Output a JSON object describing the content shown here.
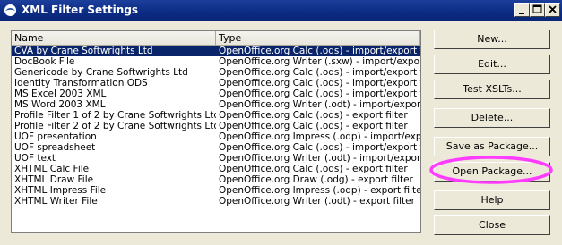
{
  "window": {
    "title": "XML Filter Settings"
  },
  "list": {
    "columns": [
      "Name",
      "Type"
    ],
    "rows": [
      {
        "name": "CVA by Crane Softwrights Ltd",
        "type": "OpenOffice.org Calc (.ods) - import/export filte",
        "selected": true
      },
      {
        "name": "DocBook File",
        "type": "OpenOffice.org Writer (.sxw) - import/export filte"
      },
      {
        "name": "Genericode by Crane Softwrights Ltd",
        "type": "OpenOffice.org Calc (.ods) - import/export filte"
      },
      {
        "name": "Identity Transformation ODS",
        "type": "OpenOffice.org Calc (.ods) - import/export filte"
      },
      {
        "name": "MS Excel 2003 XML",
        "type": "OpenOffice.org Calc (.ods) - import/export filte"
      },
      {
        "name": "MS Word 2003 XML",
        "type": "OpenOffice.org Writer (.odt) - import/export filte"
      },
      {
        "name": "Profile Filter 1 of 2 by Crane Softwrights Ltd",
        "type": "OpenOffice.org Calc (.ods) - export filter"
      },
      {
        "name": "Profile Filter 2 of 2 by Crane Softwrights Ltd",
        "type": "OpenOffice.org Calc (.ods) - export filter"
      },
      {
        "name": "UOF presentation",
        "type": "OpenOffice.org Impress (.odp) - import/export"
      },
      {
        "name": "UOF spreadsheet",
        "type": "OpenOffice.org Calc (.ods) - import/export filte"
      },
      {
        "name": "UOF text",
        "type": "OpenOffice.org Writer (.odt) - import/export filte"
      },
      {
        "name": "XHTML Calc File",
        "type": "OpenOffice.org Calc (.ods) - export filter"
      },
      {
        "name": "XHTML Draw File",
        "type": "OpenOffice.org Draw (.odg) - export filter"
      },
      {
        "name": "XHTML Impress File",
        "type": "OpenOffice.org Impress (.odp) - export filter"
      },
      {
        "name": "XHTML Writer File",
        "type": "OpenOffice.org Writer (.odt) - export filter"
      }
    ]
  },
  "buttons": {
    "new": "New...",
    "edit": "Edit...",
    "test": "Test XSLTs...",
    "delete": "Delete...",
    "save_package": "Save as Package...",
    "open_package": "Open Package...",
    "help": "Help",
    "close": "Close"
  },
  "colors": {
    "selection": "#0a246a",
    "highlight_ellipse": "#ff00ff"
  }
}
